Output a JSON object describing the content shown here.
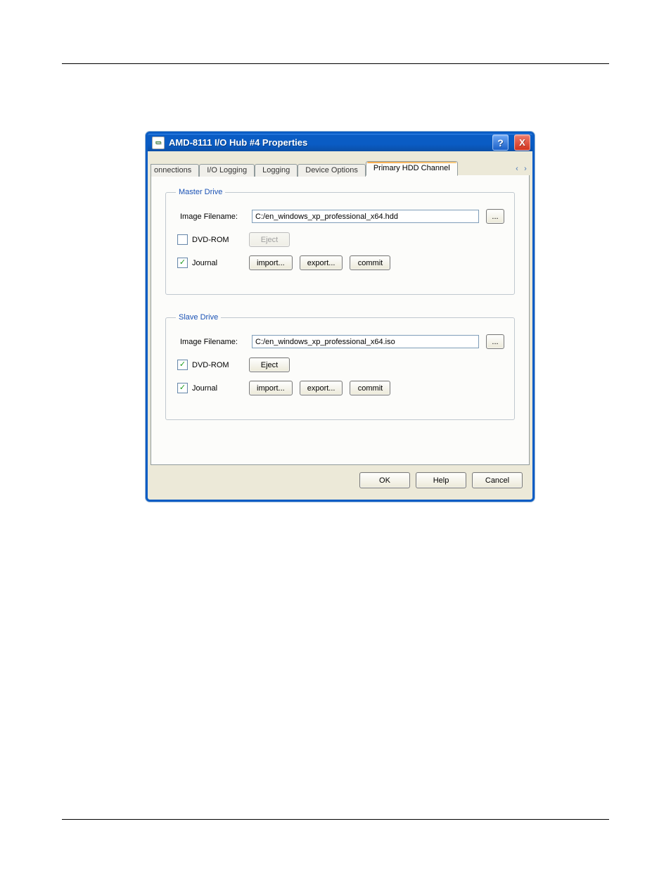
{
  "titlebar": {
    "title": "AMD-8111 I/O Hub #4 Properties",
    "help_symbol": "?",
    "close_symbol": "X"
  },
  "tabs": {
    "items": [
      {
        "label": "onnections"
      },
      {
        "label": "I/O Logging"
      },
      {
        "label": "Logging"
      },
      {
        "label": "Device Options"
      },
      {
        "label": "Primary HDD Channel"
      }
    ],
    "scroll_left": "‹",
    "scroll_right": "›"
  },
  "groups": {
    "master": {
      "legend": "Master Drive",
      "image_label": "Image Filename:",
      "image_value": "C:/en_windows_xp_professional_x64.hdd",
      "browse": "...",
      "dvd_label": "DVD-ROM",
      "dvd_checked": false,
      "eject": "Eject",
      "eject_enabled": false,
      "journal_label": "Journal",
      "journal_checked": true,
      "import": "import...",
      "export": "export...",
      "commit": "commit"
    },
    "slave": {
      "legend": "Slave Drive",
      "image_label": "Image Filename:",
      "image_value": "C:/en_windows_xp_professional_x64.iso",
      "browse": "...",
      "dvd_label": "DVD-ROM",
      "dvd_checked": true,
      "eject": "Eject",
      "eject_enabled": true,
      "journal_label": "Journal",
      "journal_checked": true,
      "import": "import...",
      "export": "export...",
      "commit": "commit"
    }
  },
  "footer": {
    "ok": "OK",
    "help": "Help",
    "cancel": "Cancel"
  }
}
